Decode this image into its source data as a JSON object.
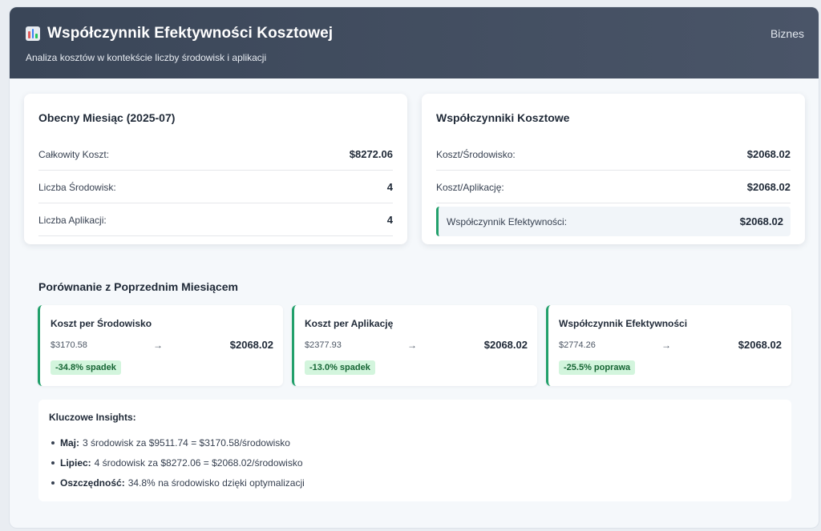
{
  "header": {
    "title": "Współczynnik Efektywności Kosztowej",
    "subtitle": "Analiza kosztów w kontekście liczby środowisk i aplikacji",
    "badge": "Biznes",
    "icon": "bar-chart-icon"
  },
  "current_month": {
    "title": "Obecny Miesiąc (2025-07)",
    "rows": [
      {
        "label": "Całkowity Koszt:",
        "value": "$8272.06"
      },
      {
        "label": "Liczba Środowisk:",
        "value": "4"
      },
      {
        "label": "Liczba Aplikacji:",
        "value": "4"
      }
    ]
  },
  "ratios": {
    "title": "Współczynniki Kosztowe",
    "rows": [
      {
        "label": "Koszt/Środowisko:",
        "value": "$2068.02"
      },
      {
        "label": "Koszt/Aplikację:",
        "value": "$2068.02"
      },
      {
        "label": "Współczynnik Efektywności:",
        "value": "$2068.02"
      }
    ]
  },
  "comparison": {
    "title": "Porównanie z Poprzednim Miesiącem",
    "arrow": "→",
    "cards": [
      {
        "title": "Koszt per Środowisko",
        "old": "$3170.58",
        "new": "$2068.02",
        "change": "-34.8% spadek"
      },
      {
        "title": "Koszt per Aplikację",
        "old": "$2377.93",
        "new": "$2068.02",
        "change": "-13.0% spadek"
      },
      {
        "title": "Współczynnik Efektywności",
        "old": "$2774.26",
        "new": "$2068.02",
        "change": "-25.5% poprawa"
      }
    ]
  },
  "insights": {
    "title": "Kluczowe Insights:",
    "items": [
      {
        "label": "Maj:",
        "text": "3 środowisk za $9511.74 = $3170.58/środowisko"
      },
      {
        "label": "Lipiec:",
        "text": "4 środowisk za $8272.06 = $2068.02/środowisko"
      },
      {
        "label": "Oszczędność:",
        "text": "34.8% na środowisko dzięki optymalizacji"
      }
    ]
  },
  "colors": {
    "header": "#3a4658",
    "accent": "#22a06b",
    "badge_bg": "#d3f5dd",
    "badge_text": "#166534"
  }
}
